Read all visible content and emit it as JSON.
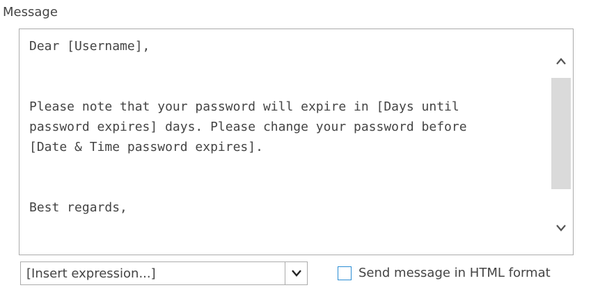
{
  "message": {
    "label": "Message",
    "text": "Dear [Username],\n\n\nPlease note that your password will expire in [Days until\npassword expires] days. Please change your password before\n[Date & Time password expires].\n\n\nBest regards,"
  },
  "scrollbar": {
    "up_icon": "chevron-up-icon",
    "down_icon": "chevron-down-icon"
  },
  "expression_select": {
    "value": "[Insert expression...]",
    "icon": "chevron-down-icon"
  },
  "html_format": {
    "label": "Send message in HTML format",
    "checked": false,
    "color": "#2a8dd4"
  }
}
